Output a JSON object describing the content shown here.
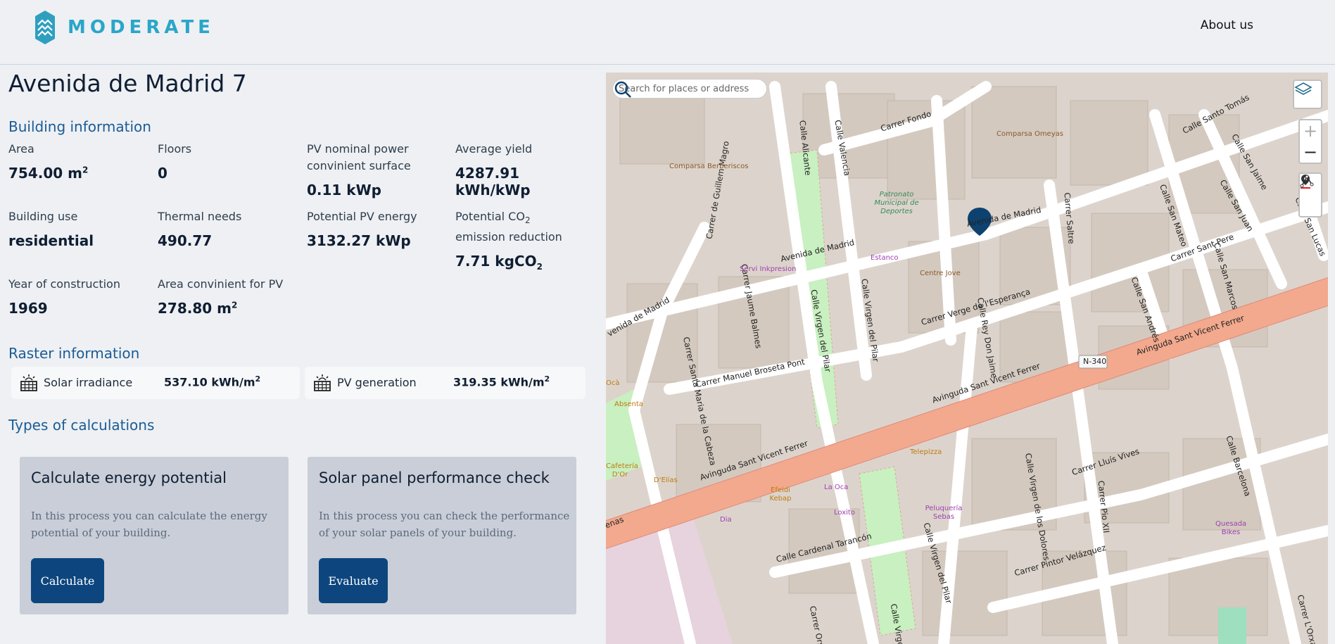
{
  "header": {
    "brand": "MODERATE",
    "nav_about": "About us",
    "colors": {
      "brand": "#2aa6c9"
    }
  },
  "page": {
    "title": "Avenida de Madrid 7"
  },
  "building_info": {
    "section_title": "Building information",
    "area": {
      "label": "Area",
      "value": "754.00 m",
      "sup": "2"
    },
    "floors": {
      "label": "Floors",
      "value": "0"
    },
    "pv_nominal": {
      "label": "PV nominal power convinient surface",
      "value": "0.11 kWp"
    },
    "average_yield": {
      "label": "Average yield",
      "value": "4287.91 kWh/kWp"
    },
    "building_use": {
      "label": "Building use",
      "value": "residential"
    },
    "thermal_needs": {
      "label": "Thermal needs",
      "value": "490.77"
    },
    "potential_pv_energy": {
      "label": "Potential PV energy",
      "value": "3132.27 kWp"
    },
    "co2_reduction": {
      "label_pre": "Potential CO",
      "label_sub": "2",
      "label_post": " emission reduction",
      "value_pre": "7.71 kgCO",
      "value_sub": "2"
    },
    "year": {
      "label": "Year of construction",
      "value": "1969"
    },
    "area_pv": {
      "label": "Area convinient for PV",
      "value": "278.80 m",
      "sup": "2"
    }
  },
  "raster_info": {
    "section_title": "Raster information",
    "solar_irradiance": {
      "label": "Solar irradiance",
      "value": "537.10 kWh/m",
      "sup": "2",
      "icon": "solar-panel-icon"
    },
    "pv_generation": {
      "label": "PV generation",
      "value": "319.35 kWh/m",
      "sup": "2",
      "icon": "solar-panel-icon"
    }
  },
  "calculations": {
    "section_title": "Types of calculations",
    "energy": {
      "title": "Calculate energy potential",
      "description": "In this process you can calculate the energy potential of your building.",
      "button": "Calculate"
    },
    "performance": {
      "title": "Solar panel performance check",
      "description": "In this process you can check the performance of your solar panels of your building.",
      "button": "Evaluate"
    }
  },
  "map": {
    "search_placeholder": "Search for places or addresses",
    "zoom_in": "+",
    "zoom_out": "−",
    "icons": [
      "layers-icon",
      "search-icon",
      "marker-icon",
      "draw-line-icon",
      "map-pin-icon"
    ],
    "streets": [
      "Carrer Fondo",
      "Calle Santo Tomás",
      "Calle Alicante",
      "Calle Valencia",
      "Carrer de Guillem Magro",
      "Avenida de Madrid",
      "Avenida de Madrid",
      "venida de Madrid",
      "Carrer Saltre",
      "Calle San Jaime",
      "Calle San Juan",
      "Calle San Lucas",
      "Calle San Mateo",
      "Carrer Sant Pere",
      "Calle San Marcos",
      "Calle Virgen del Pilar",
      "Calle Virgen del Pilar",
      "Carrer Jaume Balmes",
      "Carrer Verge de l'Esperança",
      "Calle Rey Don Jaime",
      "Calle San Andrés",
      "Carrer Santa Maria de la Cabeza",
      "Carrer Manuel Broseta Pont",
      "Avinguda Sant Vicent Ferrer",
      "Avinguda Sant Vicent Ferrer",
      "Avinguda Sant Vicent Ferrer",
      "Carrer Lluís Vives",
      "Calle Barcelona",
      "Calle Virgen de los Dolores",
      "Carrer Pio XII",
      "Carrer Pintor Velázquez",
      "Calle Cardenal Tarancón",
      "Calle Virgen del Pilar",
      "Carrer L'Orxater",
      "N-340",
      "Carrer Ors",
      "Calle Virgen",
      "enas"
    ],
    "pois": [
      "Comparsa Berberiscos",
      "Comparsa Omeyas",
      "Patronato Municipal de Deportes",
      "Estanco",
      "Centre Jove",
      "Servi Inkpresion",
      "Absenta",
      "Cafetería D'Or",
      "D'Elías",
      "Ocà",
      "Efeidi Kebap",
      "La Oca",
      "Loxito",
      "Telepizza",
      "Peluquería Sebas",
      "Dia",
      "Quesada Bikes"
    ],
    "colors": {
      "main_road": "#f2a98e",
      "park": "#c8f0c0",
      "building": "#d4cbc3",
      "marker": "#0d4270"
    }
  }
}
